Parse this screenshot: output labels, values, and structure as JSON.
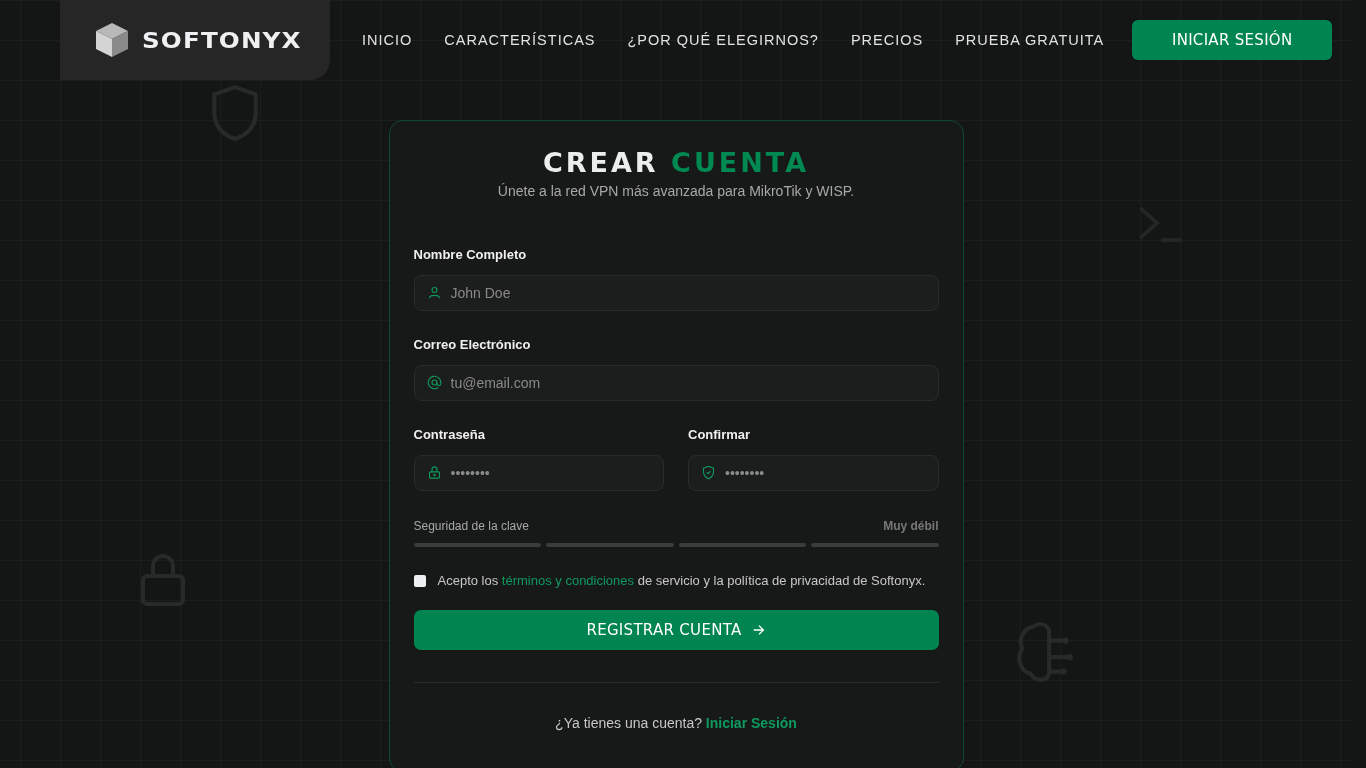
{
  "header": {
    "brand": "SOFTONYX",
    "nav": [
      {
        "label": "INICIO"
      },
      {
        "label": "CARACTERÍSTICAS"
      },
      {
        "label": "¿POR QUÉ ELEGIRNOS?"
      },
      {
        "label": "PRECIOS"
      },
      {
        "label": "PRUEBA GRATUITA"
      }
    ],
    "login_button": "INICIAR SESIÓN"
  },
  "card": {
    "title": "CREAR",
    "title_accent": "CUENTA",
    "subtitle": "Únete a la red VPN más avanzada para MikroTik y WISP.",
    "fields": [
      {
        "kind": "person",
        "label": "Nombre Completo",
        "placeholder": "John Doe"
      },
      {
        "kind": "email",
        "label": "Correo Electrónico",
        "placeholder": "tu@email.com"
      }
    ],
    "password_fields": [
      {
        "kind": "lock",
        "label": "Contraseña",
        "placeholder": "••••••••"
      },
      {
        "kind": "shield",
        "label": "Confirmar",
        "placeholder": "••••••••"
      }
    ],
    "strength": {
      "label": "Seguridad de la clave",
      "reading": "Muy débil"
    },
    "terms": {
      "checked": false,
      "before": "Acepto los",
      "link": "términos y condiciones",
      "after": "de servicio y la política de privacidad de Softonyx."
    },
    "submit_button": "REGISTRAR CUENTA",
    "footer_text": "¿Ya tienes una cuenta?",
    "footer_link": "Iniciar Sesión"
  }
}
